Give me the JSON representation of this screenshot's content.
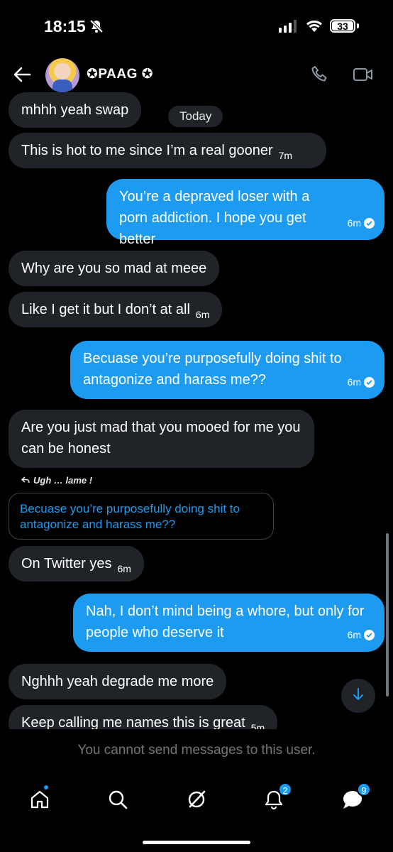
{
  "status_bar": {
    "time": "18:15",
    "battery": "33"
  },
  "header": {
    "contact_name": "✪PAAG ✪"
  },
  "date_separator": "Today",
  "messages": [
    {
      "direction": "in",
      "text": "mhhh yeah swap",
      "time": ""
    },
    {
      "direction": "in",
      "text": "This is hot to me since I’m a real gooner",
      "time": "7m"
    },
    {
      "direction": "out",
      "text": "You’re a depraved loser with a porn addiction. I hope you get better",
      "time": "6m"
    },
    {
      "direction": "in",
      "text": "Why are you so mad at meee",
      "time": ""
    },
    {
      "direction": "in",
      "text": "Like I get it but I don’t at all",
      "time": "6m"
    },
    {
      "direction": "out",
      "text": "Becuase you’re purposefully doing shit to antagonize and harass me??",
      "time": "6m"
    },
    {
      "direction": "in",
      "text": "Are you just mad that you mooed for me you can be honest",
      "time": ""
    },
    {
      "direction": "in",
      "text": "On Twitter yes",
      "time": "6m"
    },
    {
      "direction": "out",
      "text": "Nah, I don’t mind being a whore, but only for people who deserve it",
      "time": "6m"
    },
    {
      "direction": "in",
      "text": "Nghhh yeah degrade me more",
      "time": ""
    },
    {
      "direction": "in",
      "text": "Keep calling me names this is great",
      "time": "5m"
    }
  ],
  "reply": {
    "label": "Ugh … lame !",
    "quoted_text": "Becuase you’re purposefully doing shit to antagonize and harass me??"
  },
  "blocked_notice": "You cannot send messages to this user.",
  "nav": {
    "notifications_badge": "2",
    "messages_badge": "9"
  },
  "colors": {
    "accent": "#1d9bf0",
    "incoming_bubble": "#202327",
    "background": "#000000"
  },
  "icons": [
    "back-arrow-icon",
    "phone-icon",
    "video-icon",
    "home-icon",
    "search-icon",
    "grok-icon",
    "bell-icon",
    "messages-icon",
    "arrow-down-icon",
    "bell-off-icon",
    "wifi-icon",
    "reply-icon",
    "check-icon"
  ]
}
